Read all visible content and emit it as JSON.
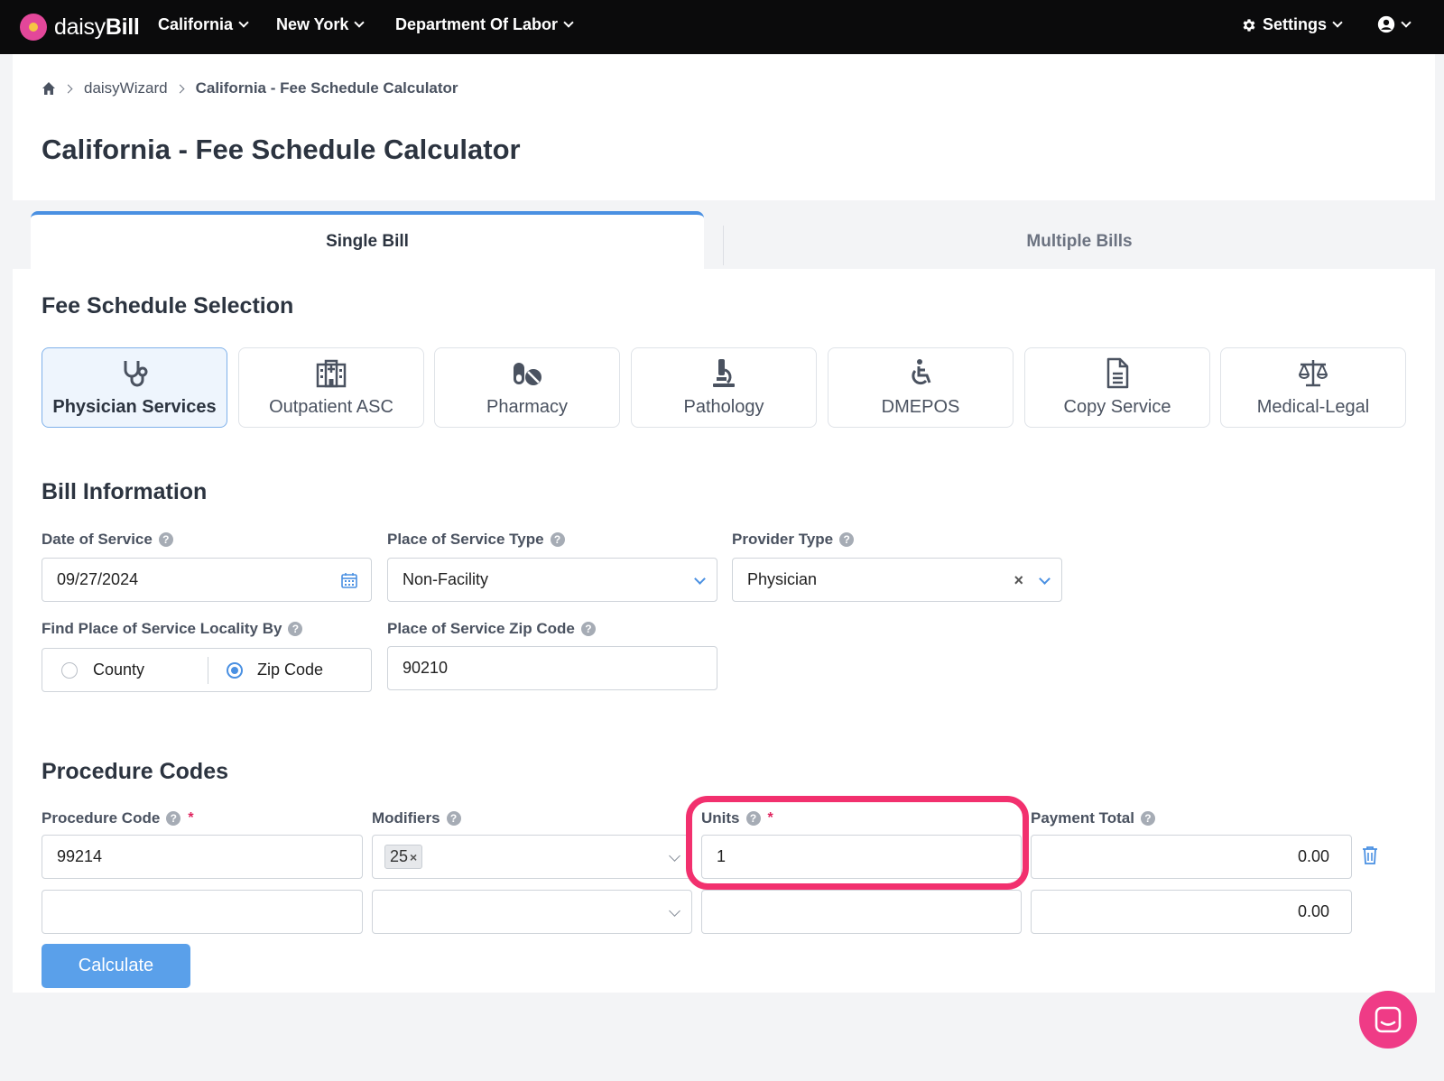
{
  "topbar": {
    "brand": {
      "prefix": "daisy",
      "suffix": "Bill"
    },
    "nav": [
      {
        "label": "California"
      },
      {
        "label": "New York"
      },
      {
        "label": "Department Of Labor"
      }
    ],
    "settings_label": "Settings"
  },
  "breadcrumb": {
    "items": [
      "daisyWizard",
      "California - Fee Schedule Calculator"
    ]
  },
  "page": {
    "title": "California - Fee Schedule Calculator"
  },
  "tabs": [
    {
      "label": "Single Bill",
      "active": true
    },
    {
      "label": "Multiple Bills",
      "active": false
    }
  ],
  "fee_schedule": {
    "title": "Fee Schedule Selection",
    "options": [
      {
        "label": "Physician Services",
        "icon": "stethoscope-icon",
        "selected": true
      },
      {
        "label": "Outpatient ASC",
        "icon": "hospital-icon",
        "selected": false
      },
      {
        "label": "Pharmacy",
        "icon": "pills-icon",
        "selected": false
      },
      {
        "label": "Pathology",
        "icon": "microscope-icon",
        "selected": false
      },
      {
        "label": "DMEPOS",
        "icon": "wheelchair-icon",
        "selected": false
      },
      {
        "label": "Copy Service",
        "icon": "document-icon",
        "selected": false
      },
      {
        "label": "Medical-Legal",
        "icon": "scale-icon",
        "selected": false
      }
    ]
  },
  "bill_info": {
    "title": "Bill Information",
    "date_of_service": {
      "label": "Date of Service",
      "value": "09/27/2024"
    },
    "place_of_service_type": {
      "label": "Place of Service Type",
      "value": "Non-Facility"
    },
    "provider_type": {
      "label": "Provider Type",
      "value": "Physician"
    },
    "locality_by": {
      "label": "Find Place of Service Locality By",
      "options": [
        {
          "label": "County",
          "selected": false
        },
        {
          "label": "Zip Code",
          "selected": true
        }
      ]
    },
    "zip_code": {
      "label": "Place of Service Zip Code",
      "value": "90210"
    }
  },
  "procedures": {
    "title": "Procedure Codes",
    "columns": {
      "code": "Procedure Code",
      "modifiers": "Modifiers",
      "units": "Units",
      "payment": "Payment Total"
    },
    "rows": [
      {
        "code": "99214",
        "modifiers": [
          "25"
        ],
        "units": "1",
        "payment": "0.00"
      },
      {
        "code": "",
        "modifiers": [],
        "units": "",
        "payment": "0.00"
      }
    ],
    "required_mark": "*",
    "help_glyph": "?",
    "calculate_label": "Calculate"
  },
  "colors": {
    "accent": "#4a90e2",
    "highlight": "#f2306e",
    "topbar": "#0b0b0c",
    "chat": "#ef3b86"
  }
}
